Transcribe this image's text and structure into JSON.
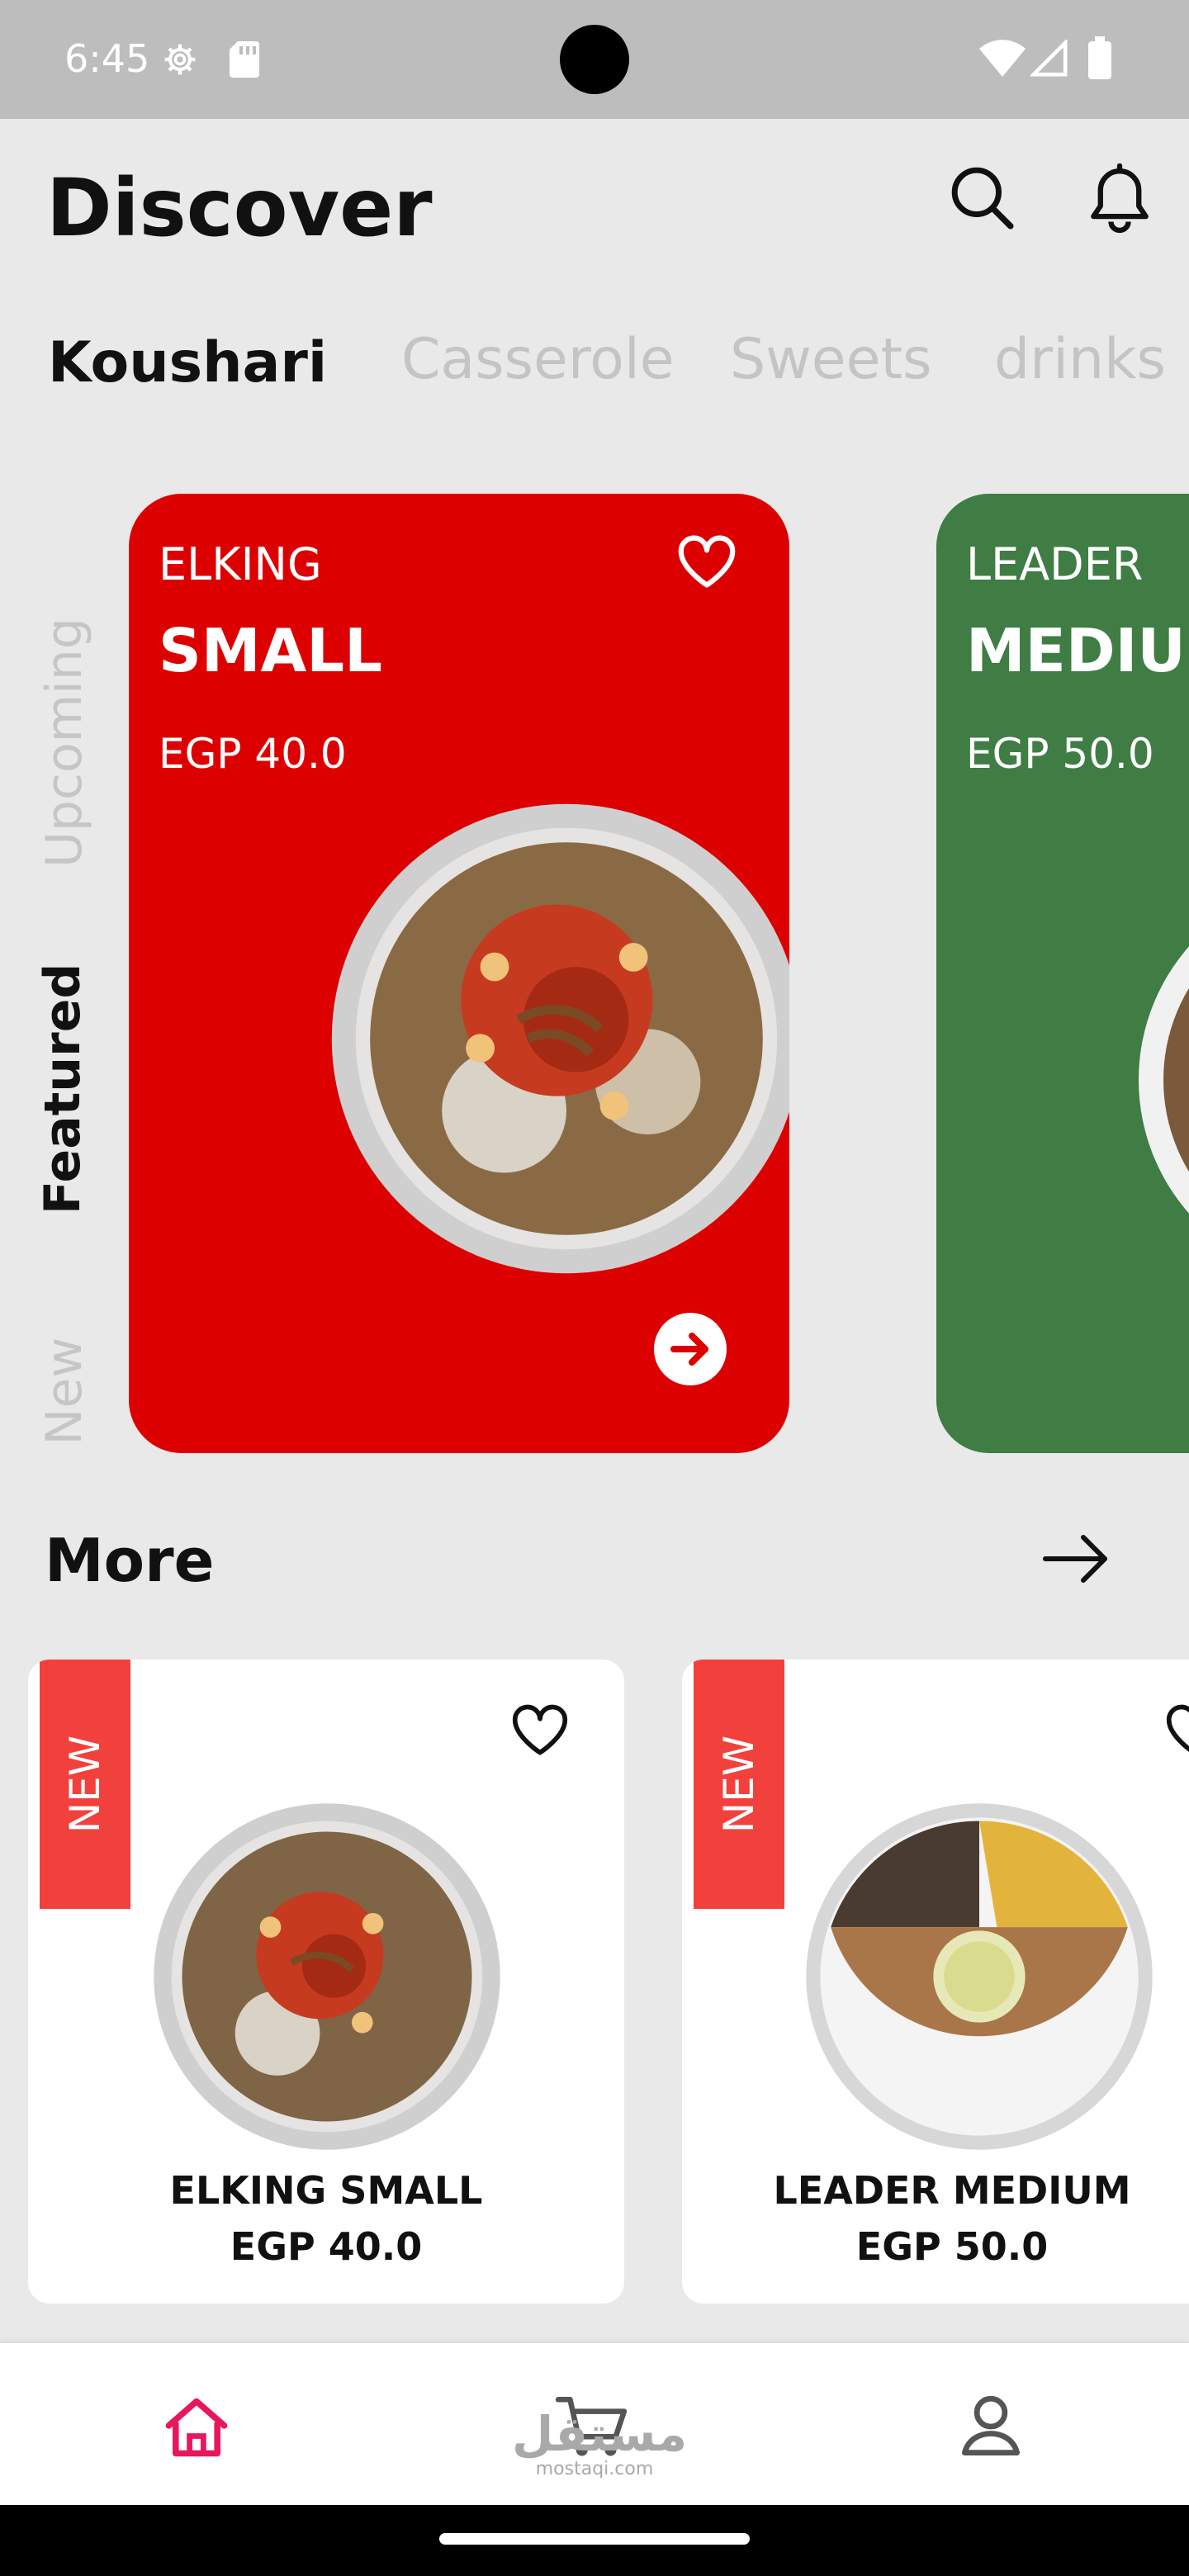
{
  "status_bar": {
    "time": "6:45"
  },
  "header": {
    "title": "Discover"
  },
  "categories": [
    {
      "label": "Koushari",
      "active": true
    },
    {
      "label": "Casserole",
      "active": false
    },
    {
      "label": "Sweets",
      "active": false
    },
    {
      "label": "drinks",
      "active": false
    }
  ],
  "side_tabs": [
    {
      "label": "Upcoming",
      "active": false
    },
    {
      "label": "Featured",
      "active": true
    },
    {
      "label": "New",
      "active": false
    }
  ],
  "featured": [
    {
      "brand": "ELKING",
      "size": "SMALL",
      "price": "EGP 40.0",
      "color": "#dd0000"
    },
    {
      "brand": "LEADER",
      "size": "MEDIUM",
      "price": "EGP 50.0",
      "color": "#3f7d44"
    }
  ],
  "more": {
    "title": "More",
    "items": [
      {
        "badge": "NEW",
        "name": "ELKING SMALL",
        "price": "EGP 40.0"
      },
      {
        "badge": "NEW",
        "name": "LEADER MEDIUM",
        "price": "EGP 50.0"
      }
    ]
  },
  "watermark": {
    "main": "مستقل",
    "sub": "mostaqi.com"
  },
  "colors": {
    "accent": "#e8175d",
    "badge": "#f2413c"
  }
}
